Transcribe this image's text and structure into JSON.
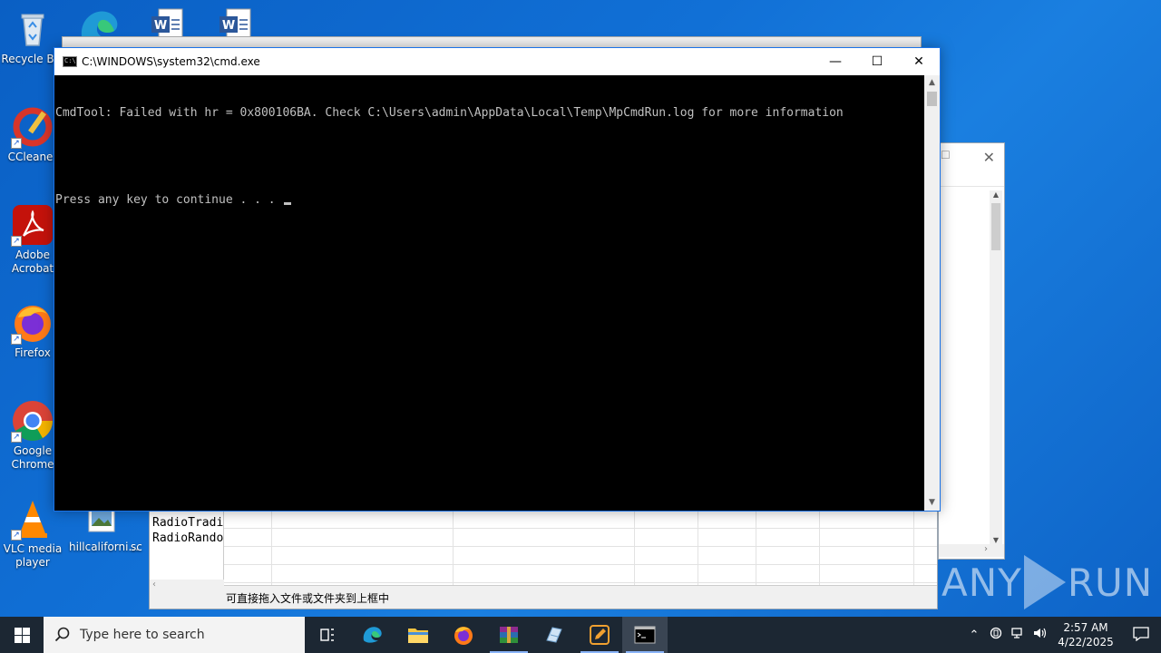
{
  "desktop": {
    "icons": [
      {
        "label": "Recycle Bin"
      },
      {
        "label": "CCleaner"
      },
      {
        "label": "Adobe Acrobat"
      },
      {
        "label": "Firefox"
      },
      {
        "label": "Google Chrome"
      },
      {
        "label": "VLC media player"
      },
      {
        "label": "hillcaliforni..."
      },
      {
        "label": "sc"
      }
    ]
  },
  "background_window": {
    "list_items": [
      "RadioTradi",
      "RadioRando"
    ],
    "status_text": "可直接拖入文件或文件夹到上框中"
  },
  "cmd_window": {
    "title": "C:\\WINDOWS\\system32\\cmd.exe",
    "lines": [
      "CmdTool: Failed with hr = 0x800106BA. Check C:\\Users\\admin\\AppData\\Local\\Temp\\MpCmdRun.log for more information",
      "",
      "Press any key to continue . . . "
    ],
    "minimize_glyph": "—",
    "maximize_glyph": "☐",
    "close_glyph": "✕"
  },
  "watermark": {
    "left": "ANY",
    "right": "RUN"
  },
  "taskbar": {
    "search_placeholder": "Type here to search",
    "time": "2:57 AM",
    "date": "4/22/2025"
  }
}
